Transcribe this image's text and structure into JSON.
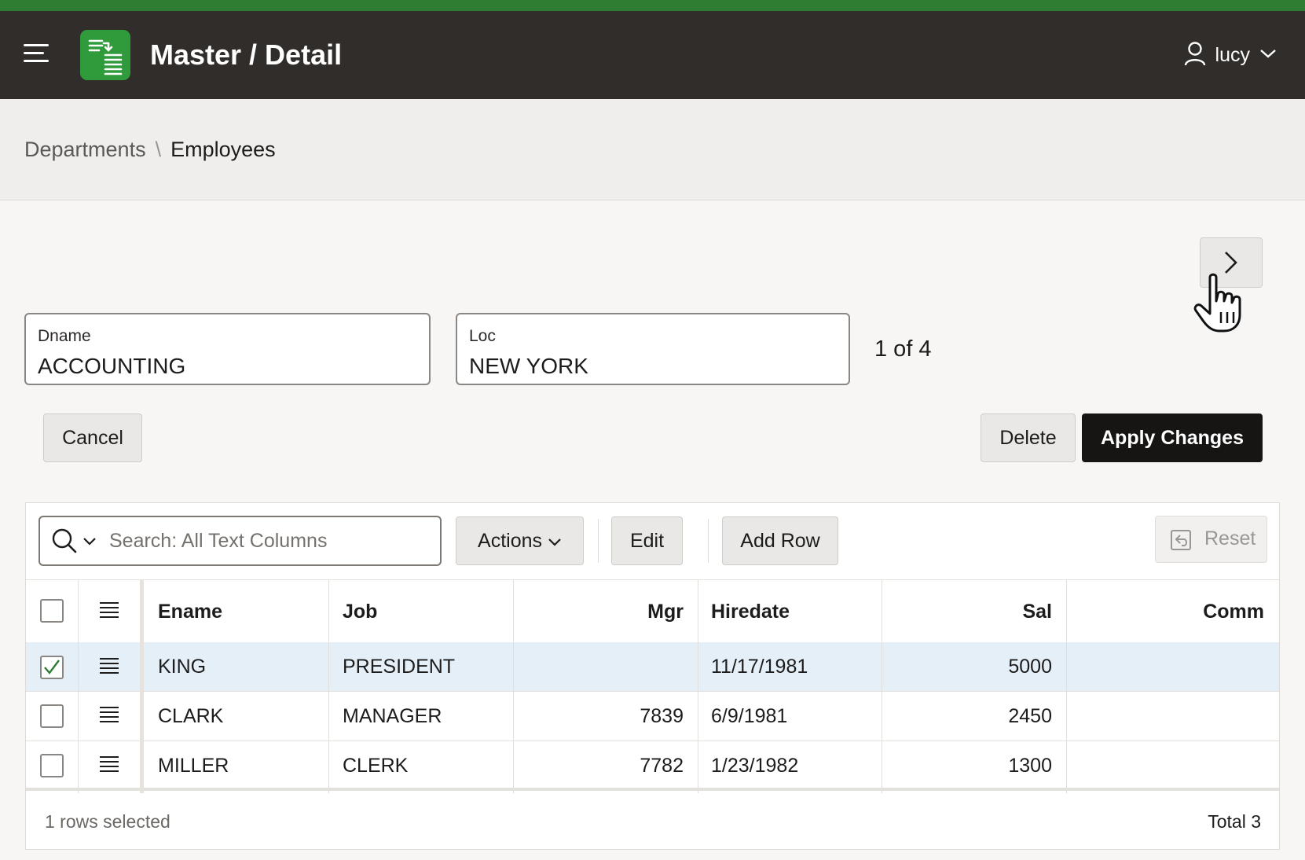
{
  "header": {
    "app_title": "Master / Detail",
    "user_name": "lucy",
    "accent_color": "#2e7d32",
    "background_color": "#312d2a",
    "icons": [
      "hamburger-menu-icon",
      "app-logo-icon",
      "user-icon",
      "chevron-down-icon"
    ]
  },
  "breadcrumb": {
    "parent": "Departments",
    "separator": "\\",
    "current": "Employees"
  },
  "form": {
    "dname": {
      "label": "Dname",
      "value": "ACCOUNTING"
    },
    "loc": {
      "label": "Loc",
      "value": "NEW YORK"
    },
    "pager_text": "1 of 4",
    "next_icon": "chevron-right-icon",
    "buttons": {
      "cancel": "Cancel",
      "delete": "Delete",
      "apply": "Apply Changes"
    }
  },
  "grid": {
    "search": {
      "placeholder": "Search: All Text Columns",
      "value": ""
    },
    "toolbar": {
      "actions": "Actions",
      "edit": "Edit",
      "add_row": "Add Row",
      "reset": "Reset"
    },
    "columns": [
      "Ename",
      "Job",
      "Mgr",
      "Hiredate",
      "Sal",
      "Comm"
    ],
    "rows": [
      {
        "selected": true,
        "ename": "KING",
        "job": "PRESIDENT",
        "mgr": "",
        "hiredate": "11/17/1981",
        "sal": "5000",
        "comm": ""
      },
      {
        "selected": false,
        "ename": "CLARK",
        "job": "MANAGER",
        "mgr": "7839",
        "hiredate": "6/9/1981",
        "sal": "2450",
        "comm": ""
      },
      {
        "selected": false,
        "ename": "MILLER",
        "job": "CLERK",
        "mgr": "7782",
        "hiredate": "1/23/1982",
        "sal": "1300",
        "comm": ""
      }
    ],
    "footer": {
      "selection_text": "1 rows selected",
      "total_text": "Total 3"
    },
    "selected_row_color": "#e5eff7"
  }
}
